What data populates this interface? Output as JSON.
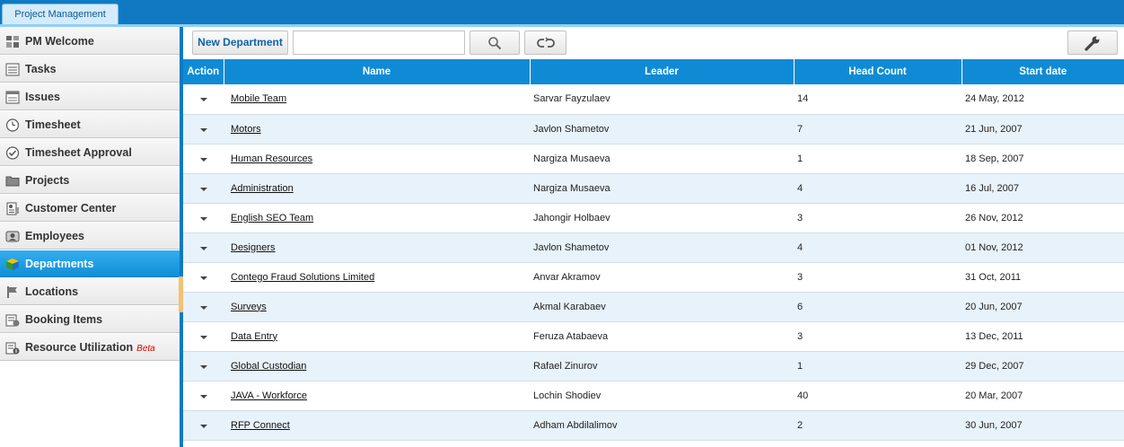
{
  "app": {
    "tab_label": "Project Management"
  },
  "sidebar": {
    "items": [
      {
        "label": "PM Welcome",
        "icon": "dashboard-icon"
      },
      {
        "label": "Tasks",
        "icon": "tasks-icon"
      },
      {
        "label": "Issues",
        "icon": "issues-icon"
      },
      {
        "label": "Timesheet",
        "icon": "clock-icon"
      },
      {
        "label": "Timesheet Approval",
        "icon": "check-circle-icon"
      },
      {
        "label": "Projects",
        "icon": "folder-icon"
      },
      {
        "label": "Customer Center",
        "icon": "customer-icon"
      },
      {
        "label": "Employees",
        "icon": "employees-icon"
      },
      {
        "label": "Departments",
        "icon": "cube-icon",
        "active": true
      },
      {
        "label": "Locations",
        "icon": "flag-icon"
      },
      {
        "label": "Booking Items",
        "icon": "booking-icon"
      },
      {
        "label": "Resource Utilization",
        "icon": "utilization-icon",
        "badge": "Beta"
      }
    ]
  },
  "toolbar": {
    "new_label": "New Department",
    "search_value": "",
    "search_icon": "search-icon",
    "refresh_icon": "refresh-icon",
    "settings_icon": "wrench-icon"
  },
  "table": {
    "columns": [
      "Action",
      "Name",
      "Leader",
      "Head Count",
      "Start date"
    ],
    "rows": [
      {
        "name": "Mobile Team",
        "leader": "Sarvar Fayzulaev",
        "head_count": "14",
        "start_date": "24 May, 2012"
      },
      {
        "name": "Motors",
        "leader": "Javlon Shametov",
        "head_count": "7",
        "start_date": "21 Jun, 2007"
      },
      {
        "name": "Human Resources",
        "leader": "Nargiza Musaeva",
        "head_count": "1",
        "start_date": "18 Sep, 2007"
      },
      {
        "name": "Administration",
        "leader": "Nargiza Musaeva",
        "head_count": "4",
        "start_date": "16 Jul, 2007"
      },
      {
        "name": "English SEO Team",
        "leader": "Jahongir Holbaev",
        "head_count": "3",
        "start_date": "26 Nov, 2012"
      },
      {
        "name": "Designers",
        "leader": "Javlon Shametov",
        "head_count": "4",
        "start_date": "01 Nov, 2012"
      },
      {
        "name": "Contego Fraud Solutions Limited",
        "leader": "Anvar Akramov",
        "head_count": "3",
        "start_date": "31 Oct, 2011"
      },
      {
        "name": "Surveys",
        "leader": "Akmal Karabaev",
        "head_count": "6",
        "start_date": "20 Jun, 2007"
      },
      {
        "name": "Data Entry",
        "leader": "Feruza Atabaeva",
        "head_count": "3",
        "start_date": "13 Dec, 2011"
      },
      {
        "name": "Global Custodian",
        "leader": "Rafael Zinurov",
        "head_count": "1",
        "start_date": "29 Dec, 2007"
      },
      {
        "name": "JAVA - Workforce",
        "leader": "Lochin Shodiev",
        "head_count": "40",
        "start_date": "20 Mar, 2007"
      },
      {
        "name": "RFP Connect",
        "leader": "Adham Abdilalimov",
        "head_count": "2",
        "start_date": "30 Jun, 2007"
      }
    ]
  },
  "colors": {
    "brand_blue": "#0f7ac2",
    "header_blue": "#0f8bd6",
    "active_item": "#1a9ee6",
    "stripe": "#e8f2fb",
    "beta_red": "#d90000"
  }
}
